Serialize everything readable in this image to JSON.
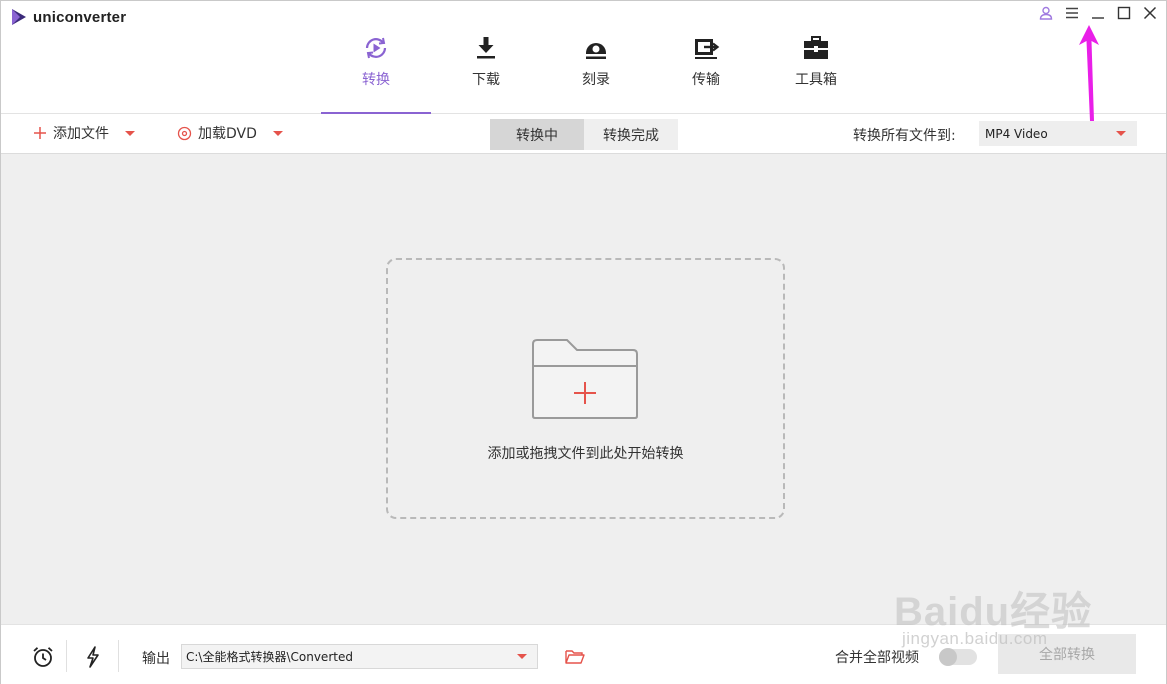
{
  "app": {
    "title": "uniconverter"
  },
  "nav": {
    "items": [
      {
        "label": "转换",
        "icon": "convert-icon",
        "active": true
      },
      {
        "label": "下载",
        "icon": "download-icon",
        "active": false
      },
      {
        "label": "刻录",
        "icon": "burn-icon",
        "active": false
      },
      {
        "label": "传输",
        "icon": "transfer-icon",
        "active": false
      },
      {
        "label": "工具箱",
        "icon": "toolbox-icon",
        "active": false
      }
    ]
  },
  "toolbar": {
    "add_files_label": "添加文件",
    "load_dvd_label": "加载DVD",
    "tabs": [
      {
        "label": "转换中",
        "active": true
      },
      {
        "label": "转换完成",
        "active": false
      }
    ],
    "convert_all_to_label": "转换所有文件到:",
    "format_value": "MP4 Video"
  },
  "main": {
    "drop_text": "添加或拖拽文件到此处开始转换"
  },
  "bottom": {
    "output_label": "输出",
    "output_path": "C:\\全能格式转换器\\Converted",
    "merge_label": "合并全部视频",
    "merge_enabled": false,
    "convert_all_button": "全部转换"
  },
  "colors": {
    "accent": "#8a63d2",
    "action_red": "#e5534b",
    "annotation_magenta": "#e91fe8"
  },
  "watermark": {
    "text": "Baidu经验",
    "sub": "jingyan.baidu.com"
  }
}
